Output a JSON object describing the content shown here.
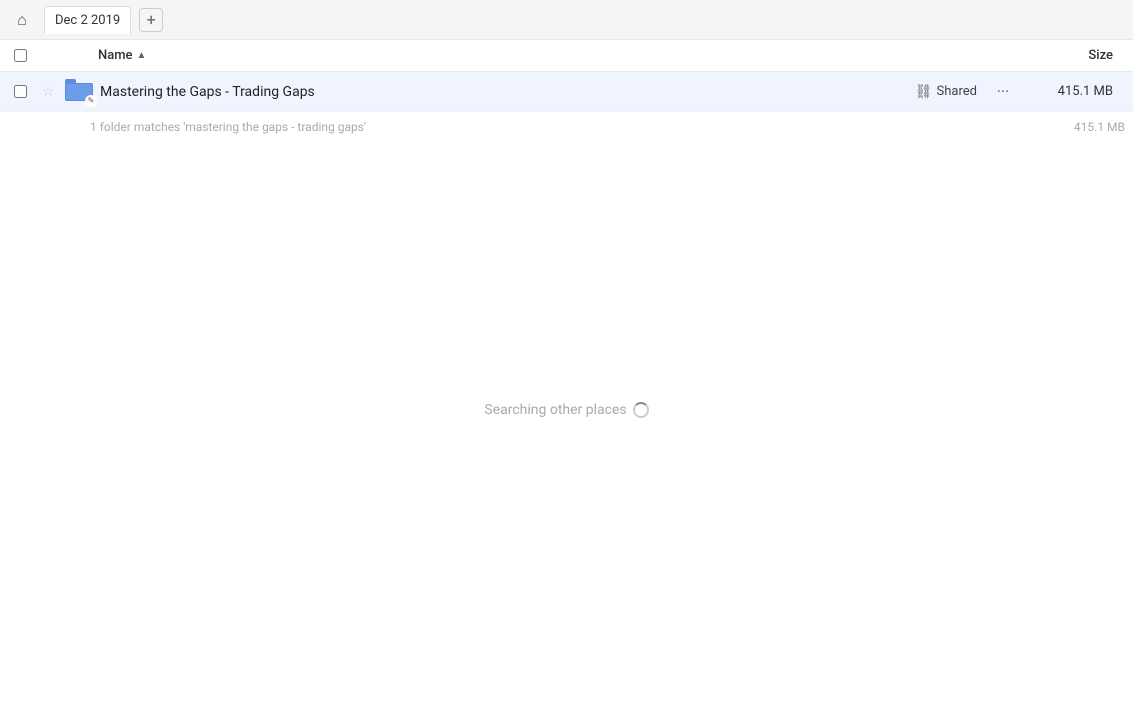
{
  "topbar": {
    "home_icon": "🏠",
    "tab_label": "Dec 2 2019",
    "add_tab_icon": "+"
  },
  "columns": {
    "name_label": "Name",
    "sort_indicator": "▲",
    "size_label": "Size"
  },
  "file_row": {
    "name": "Mastering the Gaps - Trading Gaps",
    "shared_label": "Shared",
    "more_icon": "···",
    "size": "415.1 MB",
    "link_icon": "🔗",
    "star_icon": "☆"
  },
  "match_info": {
    "text": "1 folder matches 'mastering the gaps - trading gaps'",
    "size": "415.1 MB"
  },
  "searching": {
    "text": "Searching other places"
  }
}
